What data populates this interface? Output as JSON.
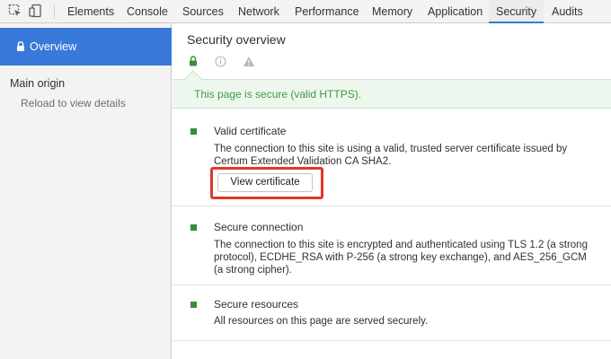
{
  "toolbar": {
    "tabs": [
      "Elements",
      "Console",
      "Sources",
      "Network",
      "Performance",
      "Memory",
      "Application",
      "Security",
      "Audits"
    ],
    "active_tab": "Security",
    "accent_color": "#3879d9"
  },
  "sidebar": {
    "overview_label": "Overview",
    "main_origin_label": "Main origin",
    "reload_hint": "Reload to view details"
  },
  "main": {
    "title": "Security overview",
    "state_icons": [
      "lock-icon",
      "info-icon",
      "warning-icon"
    ],
    "banner_text": "This page is secure (valid HTTPS).",
    "sections": [
      {
        "title": "Valid certificate",
        "description": "The connection to this site is using a valid, trusted server certificate issued by Certum Extended Validation CA SHA2.",
        "button_label": "View certificate"
      },
      {
        "title": "Secure connection",
        "description": "The connection to this site is encrypted and authenticated using TLS 1.2 (a strong protocol), ECDHE_RSA with P-256 (a strong key exchange), and AES_256_GCM (a strong cipher)."
      },
      {
        "title": "Secure resources",
        "description": "All resources on this page are served securely."
      }
    ]
  },
  "colors": {
    "secure_green": "#3a8c3a",
    "banner_text": "#3e9a3e",
    "highlight_red": "#e0382b"
  }
}
